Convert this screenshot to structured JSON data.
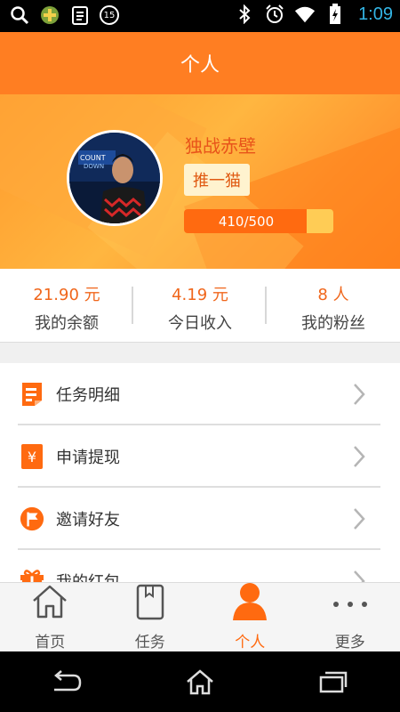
{
  "status_bar": {
    "time": "1:09",
    "notification_badge": "15",
    "icons": [
      "search-icon",
      "game-app-icon",
      "clipboard-icon",
      "notification-badge",
      "bluetooth-icon",
      "alarm-icon",
      "wifi-icon",
      "battery-icon"
    ]
  },
  "header": {
    "title": "个人"
  },
  "profile": {
    "username": "独战赤壁",
    "tag": "推一猫",
    "progress_text": "410/500",
    "progress_value": 0.82,
    "avatar_icon": "user-photo"
  },
  "stats": [
    {
      "value": "21.90 元",
      "label": "我的余额"
    },
    {
      "value": "4.19 元",
      "label": "今日收入"
    },
    {
      "value": "8 人",
      "label": "我的粉丝"
    }
  ],
  "menu": [
    {
      "label": "任务明细",
      "icon": "task-list-icon"
    },
    {
      "label": "申请提现",
      "icon": "yen-icon"
    },
    {
      "label": "邀请好友",
      "icon": "flag-icon"
    },
    {
      "label": "我的红包",
      "icon": "gift-icon"
    }
  ],
  "tabs": [
    {
      "label": "首页",
      "icon": "home-icon",
      "active": false
    },
    {
      "label": "任务",
      "icon": "book-icon",
      "active": false
    },
    {
      "label": "个人",
      "icon": "person-icon",
      "active": true
    },
    {
      "label": "更多",
      "icon": "more-icon",
      "active": false
    }
  ],
  "colors": {
    "accent": "#ff7e22",
    "highlight": "#ff6a10",
    "status_time": "#33b5e5"
  }
}
